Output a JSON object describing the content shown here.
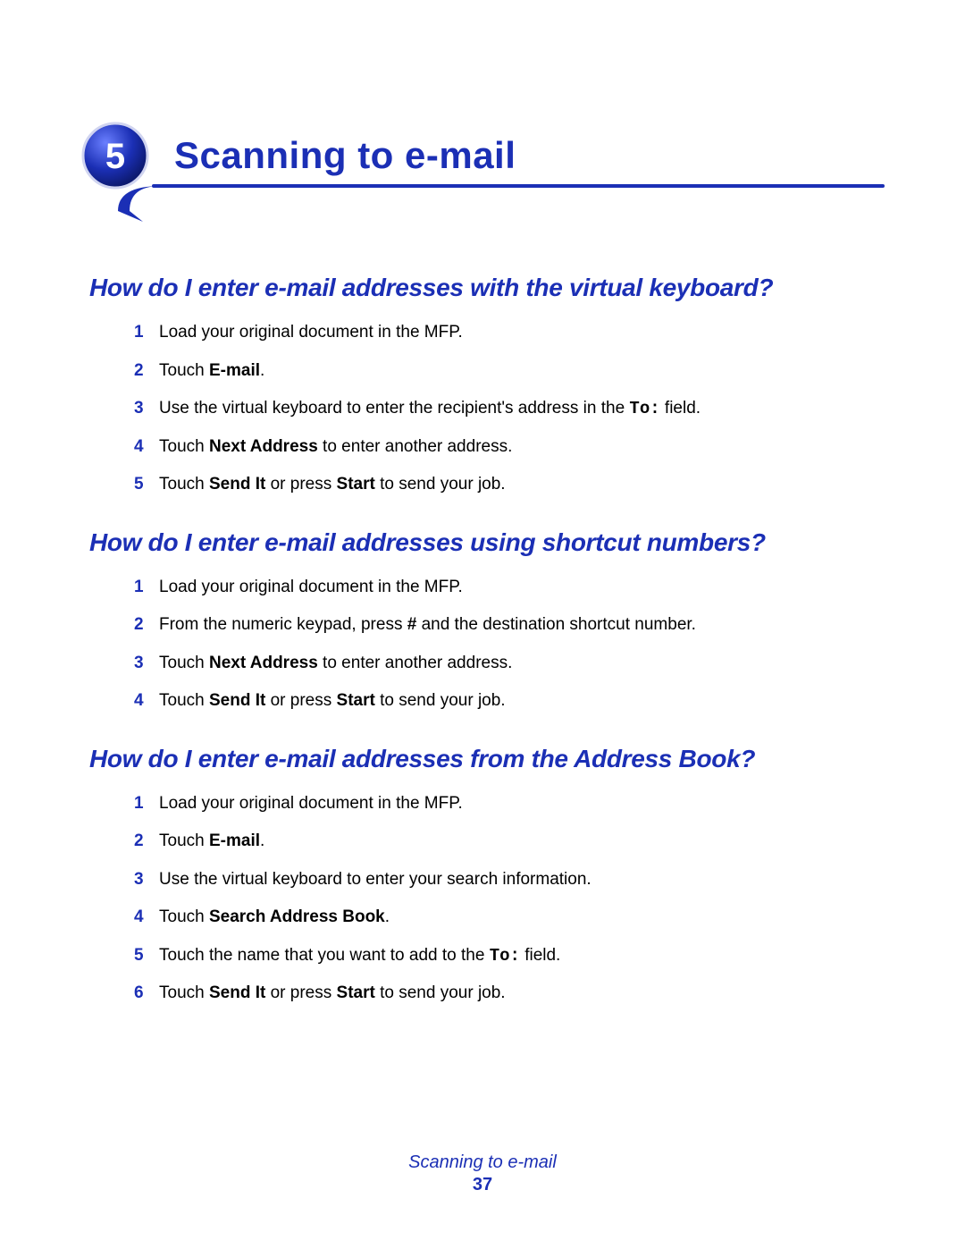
{
  "chapter": {
    "number": "5",
    "title": "Scanning to e-mail"
  },
  "sections": [
    {
      "heading": "How do I enter e-mail addresses with the virtual keyboard?",
      "steps": [
        {
          "num": "1",
          "html": "Load your original document in the MFP."
        },
        {
          "num": "2",
          "html": "Touch <b>E-mail</b>."
        },
        {
          "num": "3",
          "html": "Use the virtual keyboard to enter the recipient's address in the <code>To:</code> field."
        },
        {
          "num": "4",
          "html": "Touch <b>Next Address</b> to enter another address."
        },
        {
          "num": "5",
          "html": "Touch <b>Send It</b> or press <b>Start</b> to send your job."
        }
      ]
    },
    {
      "heading": "How do I enter e-mail addresses using shortcut numbers?",
      "steps": [
        {
          "num": "1",
          "html": "Load your original document in the MFP."
        },
        {
          "num": "2",
          "html": "From the numeric keypad, press <b>#</b> and the destination shortcut number."
        },
        {
          "num": "3",
          "html": "Touch <b>Next Address</b> to enter another address."
        },
        {
          "num": "4",
          "html": "Touch <b>Send It</b> or press <b>Start</b> to send your job."
        }
      ]
    },
    {
      "heading": "How do I enter e-mail addresses from the Address Book?",
      "steps": [
        {
          "num": "1",
          "html": "Load your original document in the MFP."
        },
        {
          "num": "2",
          "html": "Touch <b>E-mail</b>."
        },
        {
          "num": "3",
          "html": "Use the virtual keyboard to enter your search information."
        },
        {
          "num": "4",
          "html": "Touch <b>Search Address Book</b>."
        },
        {
          "num": "5",
          "html": "Touch the name that you want to add to the <code>To:</code> field."
        },
        {
          "num": "6",
          "html": "Touch <b>Send It</b> or press <b>Start</b> to send your job."
        }
      ]
    }
  ],
  "footer": {
    "title": "Scanning to e-mail",
    "page_number": "37"
  }
}
